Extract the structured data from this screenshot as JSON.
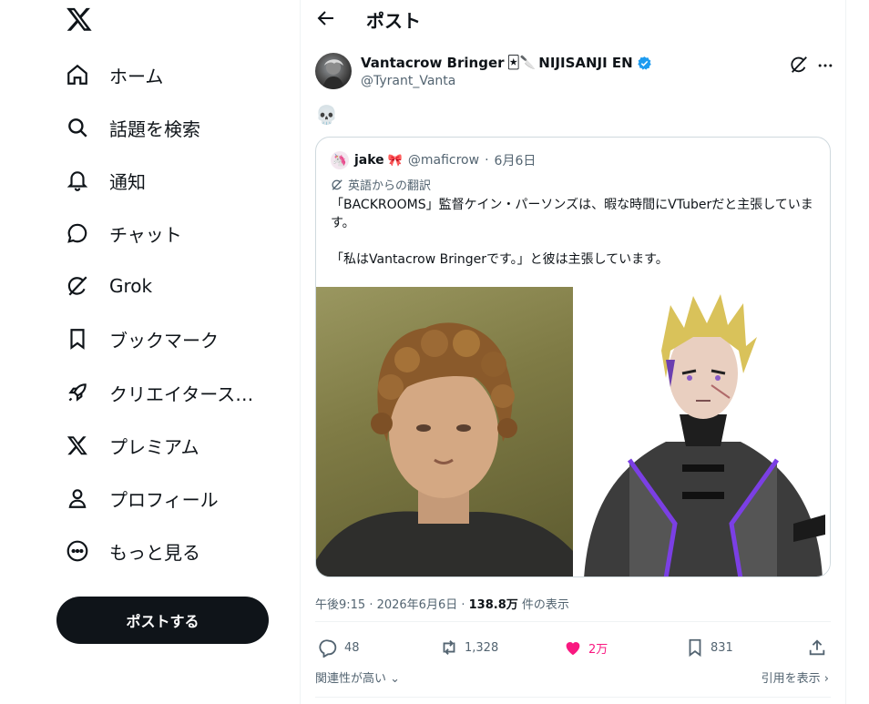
{
  "sidebar": {
    "items": [
      {
        "label": "ホーム",
        "icon": "home-icon"
      },
      {
        "label": "話題を検索",
        "icon": "search-icon"
      },
      {
        "label": "通知",
        "icon": "bell-icon"
      },
      {
        "label": "チャット",
        "icon": "chat-icon"
      },
      {
        "label": "Grok",
        "icon": "grok-icon"
      },
      {
        "label": "ブックマーク",
        "icon": "bookmark-icon"
      },
      {
        "label": "クリエイタース…",
        "icon": "rocket-icon"
      },
      {
        "label": "プレミアム",
        "icon": "x-logo-icon"
      },
      {
        "label": "プロフィール",
        "icon": "person-icon"
      },
      {
        "label": "もっと見る",
        "icon": "more-circle-icon"
      }
    ],
    "post_button": "ポストする"
  },
  "header": {
    "title": "ポスト"
  },
  "tweet": {
    "author_name": "Vantacrow Bringer",
    "author_emoji": "🃏🔪",
    "author_suffix": "NIJISANJI EN",
    "handle": "@Tyrant_Vanta",
    "text": "💀",
    "timestamp": "午後9:15 · 2026年6月6日 · ",
    "views": "138.8万",
    "views_suffix": " 件の表示"
  },
  "quote": {
    "name": "jake",
    "name_emoji": "🎀",
    "avatar_emoji": "🦄",
    "handle": "@maficrow",
    "date": "6月6日",
    "translation_label": "英語からの翻訳",
    "body": "「BACKROOMS」監督ケイン・パーソンズは、暇な時間にVTuberだと主張しています。\n\n「私はVantacrow Bringerです。」と彼は主張しています。"
  },
  "actions": {
    "replies": "48",
    "reposts": "1,328",
    "likes": "2万",
    "bookmarks": "831"
  },
  "footer": {
    "sort_label": "関連性が高い",
    "quotes_label": "引用を表示"
  },
  "colors": {
    "text": "#0f1419",
    "muted": "#536471",
    "like_pink": "#f91880",
    "verified_blue": "#1d9bf0",
    "accent_purple": "#7b3fe4"
  }
}
